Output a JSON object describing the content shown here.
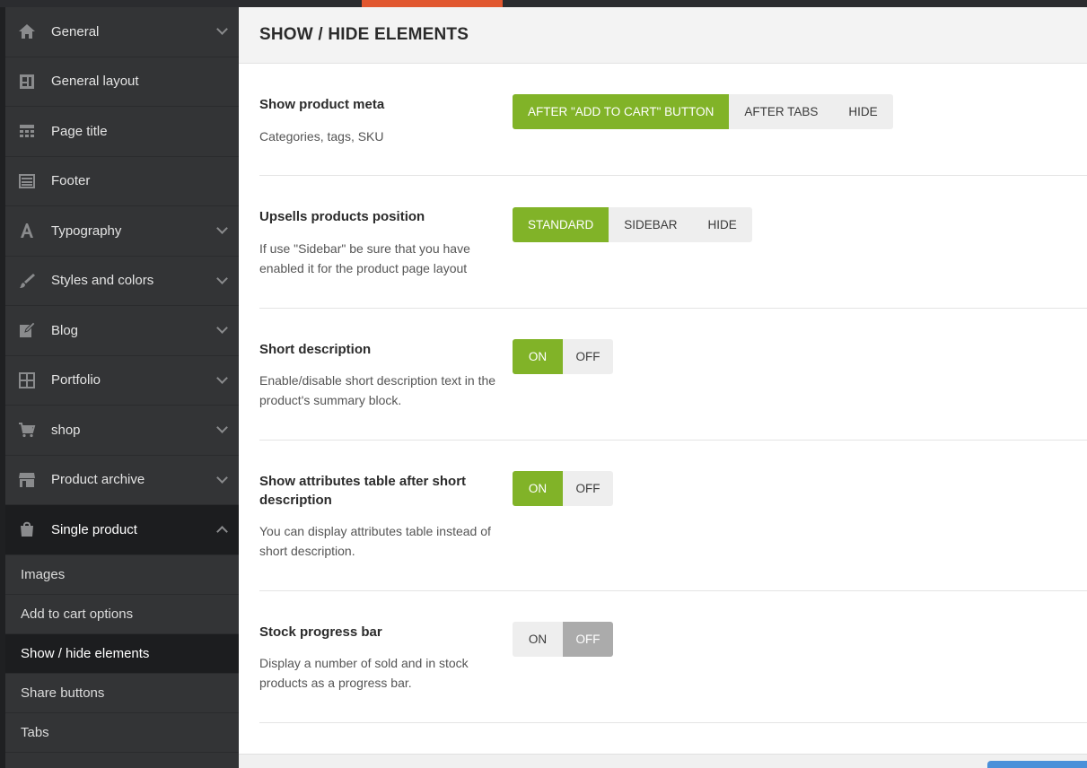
{
  "colors": {
    "accent": "#81b328",
    "top_accent": "#e1572f",
    "off_selected": "#ababab",
    "save": "#4a90d9"
  },
  "sidebar": {
    "items": [
      {
        "label": "General",
        "icon": "home-icon",
        "expandable": true
      },
      {
        "label": "General layout",
        "icon": "layout-icon",
        "expandable": false
      },
      {
        "label": "Page title",
        "icon": "page-title-icon",
        "expandable": false
      },
      {
        "label": "Footer",
        "icon": "footer-icon",
        "expandable": false
      },
      {
        "label": "Typography",
        "icon": "typography-icon",
        "expandable": true
      },
      {
        "label": "Styles and colors",
        "icon": "brush-icon",
        "expandable": true
      },
      {
        "label": "Blog",
        "icon": "edit-icon",
        "expandable": true
      },
      {
        "label": "Portfolio",
        "icon": "grid-icon",
        "expandable": true
      },
      {
        "label": "shop",
        "icon": "cart-icon",
        "expandable": true
      },
      {
        "label": "Product archive",
        "icon": "store-icon",
        "expandable": true
      },
      {
        "label": "Single product",
        "icon": "bag-icon",
        "expandable": true,
        "active": true
      }
    ],
    "subitems": [
      {
        "label": "Images"
      },
      {
        "label": "Add to cart options"
      },
      {
        "label": "Show / hide elements",
        "current": true
      },
      {
        "label": "Share buttons"
      },
      {
        "label": "Tabs"
      }
    ]
  },
  "main": {
    "title": "SHOW / HIDE ELEMENTS",
    "options": [
      {
        "title": "Show product meta",
        "desc": "Categories, tags, SKU",
        "buttons": [
          "AFTER \"ADD TO CART\" BUTTON",
          "AFTER TABS",
          "HIDE"
        ],
        "selected": 0
      },
      {
        "title": "Upsells products position",
        "desc": "If use \"Sidebar\" be sure that you have enabled it for the product page layout",
        "buttons": [
          "STANDARD",
          "SIDEBAR",
          "HIDE"
        ],
        "selected": 0
      },
      {
        "title": "Short description",
        "desc": "Enable/disable short description text in the product's summary block.",
        "buttons": [
          "ON",
          "OFF"
        ],
        "selected": 0
      },
      {
        "title": "Show attributes table after short description",
        "desc": "You can display attributes table instead of short description.",
        "buttons": [
          "ON",
          "OFF"
        ],
        "selected": 0
      },
      {
        "title": "Stock progress bar",
        "desc": "Display a number of sold and in stock products as a progress bar.",
        "buttons": [
          "ON",
          "OFF"
        ],
        "selected": 1
      }
    ]
  }
}
